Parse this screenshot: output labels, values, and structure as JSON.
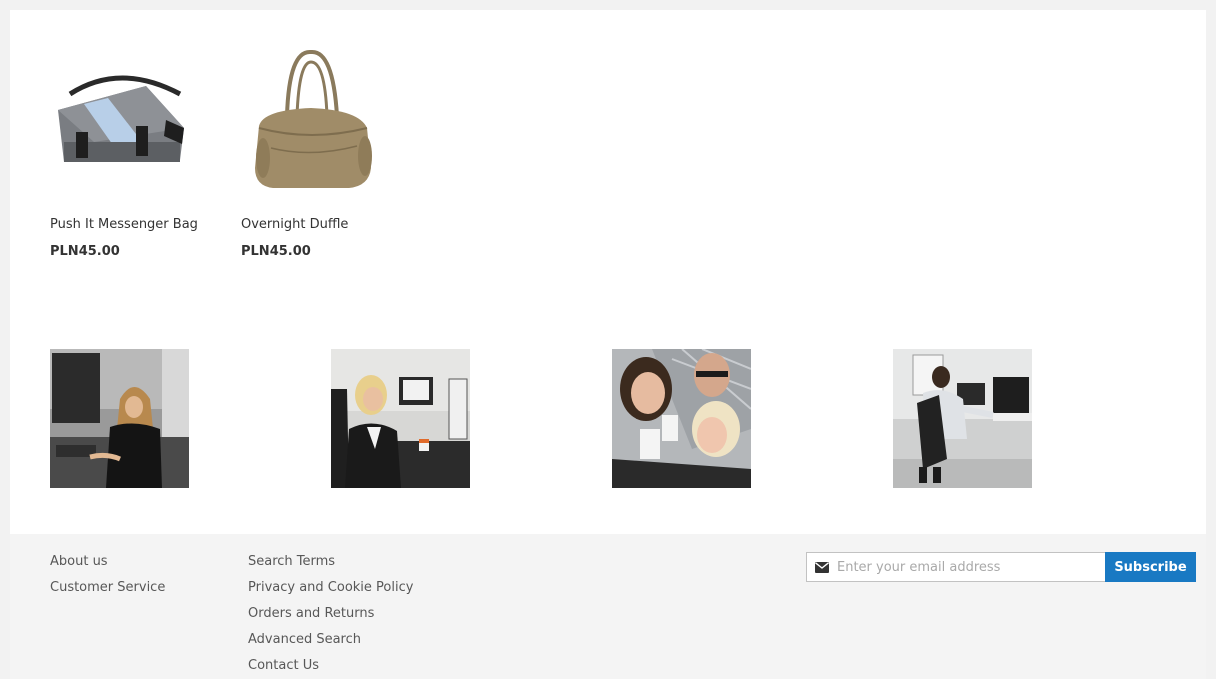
{
  "products": [
    {
      "name": "Push It Messenger Bag",
      "price": "PLN45.00",
      "image_icon": "messenger-bag-image"
    },
    {
      "name": "Overnight Duffle",
      "price": "PLN45.00",
      "image_icon": "duffle-bag-image"
    }
  ],
  "gallery": {
    "photos": [
      "woman-at-desk-photo",
      "woman-with-mug-photo",
      "group-selfie-photo",
      "man-at-desk-photo"
    ]
  },
  "footer": {
    "column1": [
      "About us",
      "Customer Service"
    ],
    "column2": [
      "Search Terms",
      "Privacy and Cookie Policy",
      "Orders and Returns",
      "Advanced Search",
      "Contact Us"
    ],
    "newsletter": {
      "placeholder": "Enter your email address",
      "button_label": "Subscribe"
    }
  },
  "colors": {
    "accent": "#1979c3",
    "footer_bg": "#f4f4f4",
    "link": "#575757"
  }
}
